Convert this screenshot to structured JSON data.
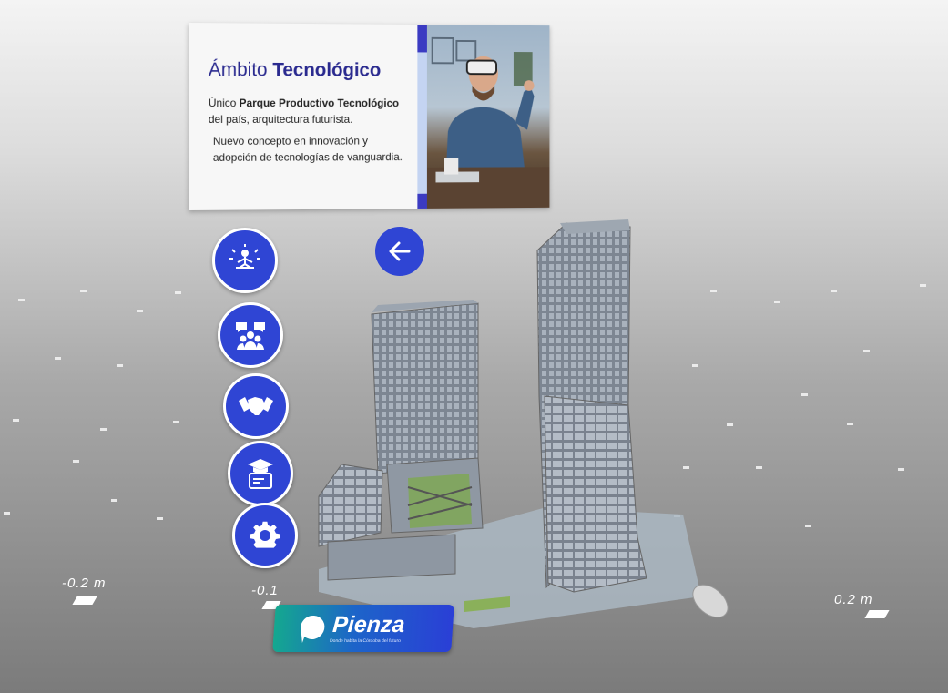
{
  "card": {
    "title_prefix": "Ámbito",
    "title_bold": "Tecnológico",
    "line1_prefix": "Único",
    "line1_bold": "Parque Productivo Tecnológico",
    "line2": "del país, arquitectura futurista.",
    "line3": "Nuevo concepto en innovación y",
    "line4": "adopción de tecnologías de vanguardia."
  },
  "menu": {
    "items": [
      {
        "icon": "meditation-icon"
      },
      {
        "icon": "community-icon"
      },
      {
        "icon": "handshake-icon"
      },
      {
        "icon": "education-icon"
      },
      {
        "icon": "gear-icon"
      }
    ],
    "back_icon": "arrow-left-icon"
  },
  "scale": {
    "left": "-0.2 m",
    "mid_left": "-0.1",
    "right": "0.2 m"
  },
  "logo": {
    "name": "Pienza",
    "tagline": "Donde habita la Córdoba del futuro"
  },
  "colors": {
    "accent": "#2f45d4",
    "title": "#2a2a8f"
  }
}
